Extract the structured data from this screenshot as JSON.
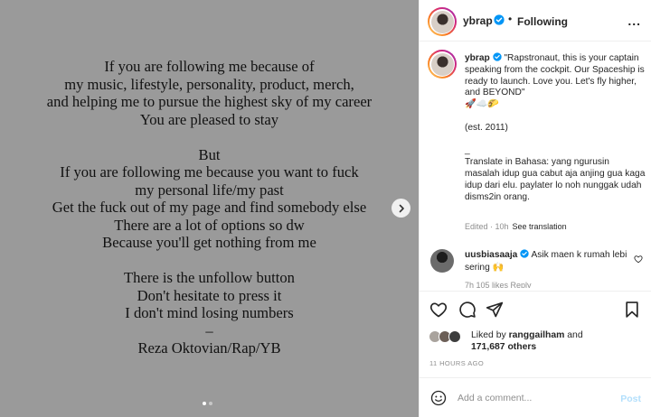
{
  "post": {
    "image_lines": [
      "If you are following me because of",
      "my music, lifestyle, personality, product, merch,",
      "and helping me to pursue the highest sky of my career",
      "You are pleased to stay",
      "",
      "But",
      "If you are following me because you want to fuck",
      "my personal life/my past",
      "Get the fuck out of my page and find somebody else",
      "There are a lot of options so dw",
      "Because you'll get nothing from me",
      "",
      "There is the unfollow button",
      "Don't hesitate to press it",
      "I don't mind losing numbers",
      "–",
      "Reza Oktovian/Rap/YB"
    ],
    "carousel": {
      "count": 2,
      "active": 0
    }
  },
  "header": {
    "username": "ybrap",
    "separator": "•",
    "follow_status": "Following",
    "more": "..."
  },
  "caption": {
    "username": "ybrap",
    "text": "\"Rapstronaut, this is your captain speaking from the cockpit. Our Spaceship is ready to launch. Love you. Let's fly higher, and BEYOND\"\n🚀☁️🌮\n\n(est. 2011)\n\n_\nTranslate in Bahasa: yang ngurusin masalah idup gua cabut aja anjing gua kaga idup dari elu. paylater lo noh nunggak udah disms2in orang.",
    "edited": "Edited · 10h",
    "see_translation": "See translation"
  },
  "comment": {
    "username": "uusbiasaaja",
    "text": "Asik maen k rumah lebi sering 🙌",
    "meta": "7h   105 likes   Reply"
  },
  "likes": {
    "prefix": "Liked by",
    "user": "ranggailham",
    "and": "and",
    "others": "171,687 others"
  },
  "timestamp": "11 HOURS AGO",
  "add_comment": {
    "placeholder": "Add a comment...",
    "post_label": "Post"
  },
  "colors": {
    "verified": "#0095f6",
    "post_disabled": "#b2dffc",
    "image_bg": "#9a9a9a"
  },
  "icons": [
    "verified-badge-icon",
    "chevron-right-icon",
    "heart-icon",
    "comment-icon",
    "share-icon",
    "bookmark-icon",
    "emoji-icon",
    "more-icon"
  ]
}
